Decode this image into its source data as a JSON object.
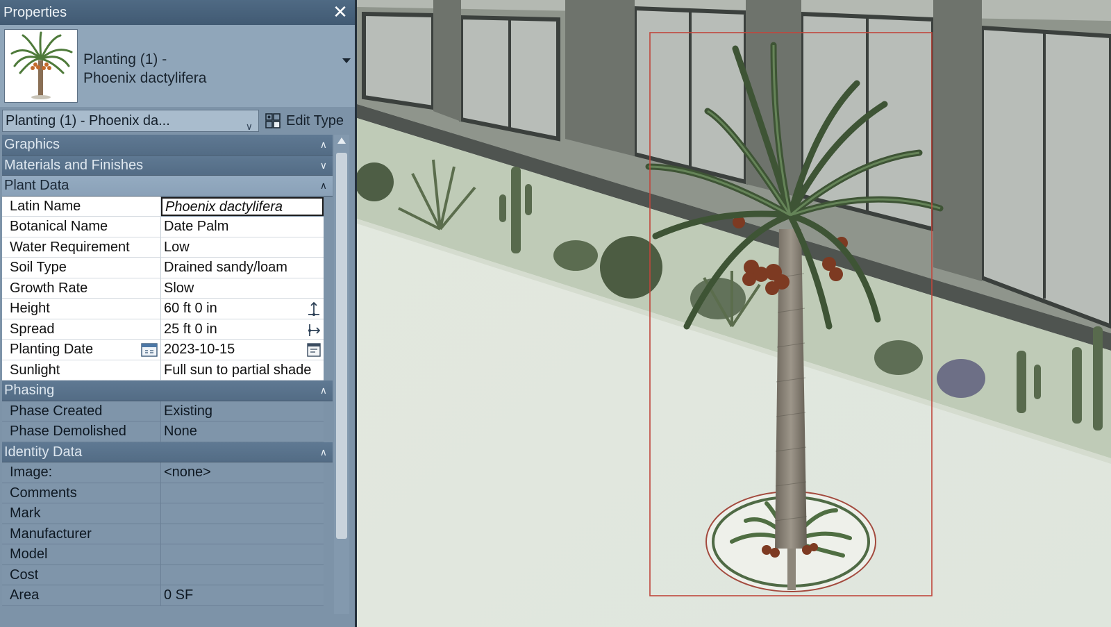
{
  "panel": {
    "title": "Properties",
    "close_glyph": "✕",
    "type_family_line1": "Planting (1) -",
    "type_family_line2": "Phoenix dactylifera",
    "type_selector": "Planting (1) - Phoenix da...",
    "edit_type_label": "Edit Type",
    "collapsed_chevron": "⌅",
    "groups": {
      "graphics": "Graphics",
      "materials": "Materials and Finishes",
      "plant_data": "Plant Data",
      "phasing": "Phasing",
      "identity": "Identity Data"
    },
    "plant_data": [
      {
        "key": "Latin Name",
        "value": "Phoenix dactylifera"
      },
      {
        "key": "Botanical Name",
        "value": "Date Palm"
      },
      {
        "key": "Water Requirement",
        "value": "Low"
      },
      {
        "key": "Soil Type",
        "value": "Drained sandy/loam"
      },
      {
        "key": "Growth Rate",
        "value": "Slow"
      },
      {
        "key": "Height",
        "value": "60 ft 0 in"
      },
      {
        "key": "Spread",
        "value": "25 ft 0 in"
      },
      {
        "key": "Planting Date",
        "value": "2023-10-15"
      },
      {
        "key": "Sunlight",
        "value": "Full sun to partial shade"
      }
    ],
    "phasing": [
      {
        "key": "Phase Created",
        "value": "Existing"
      },
      {
        "key": "Phase Demolished",
        "value": "None"
      }
    ],
    "identity": [
      {
        "key": "Image:",
        "value": "<none>"
      },
      {
        "key": "Comments",
        "value": ""
      },
      {
        "key": "Mark",
        "value": ""
      },
      {
        "key": "Manufacturer",
        "value": ""
      },
      {
        "key": "Model",
        "value": ""
      },
      {
        "key": "Cost",
        "value": ""
      },
      {
        "key": "Area",
        "value": "0 SF"
      }
    ]
  },
  "icons": {
    "close": "close-icon",
    "dropdown": "chevron-down-icon",
    "edit_type": "edit-type-icon",
    "height_dim": "vertical-dimension-icon",
    "spread_dim": "horizontal-dimension-icon",
    "calendar": "calendar-icon",
    "collapse": "collapse-chevron-icon"
  },
  "colors": {
    "title_bar": "#4a647d",
    "panel_bg": "#7d93a8",
    "group_header": "#5a7490",
    "selection_box": "#c0473c"
  }
}
